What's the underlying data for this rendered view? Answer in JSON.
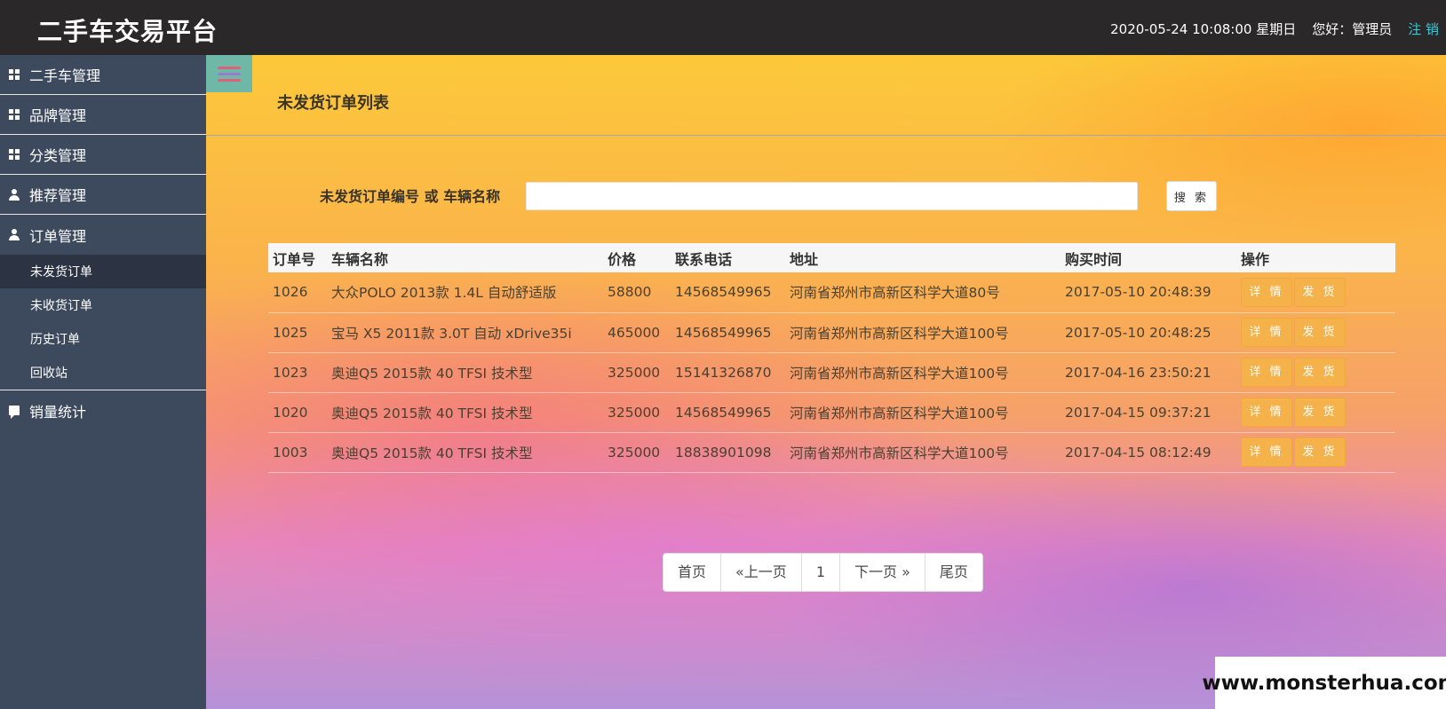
{
  "header": {
    "title": "二手车交易平台",
    "datetime": "2020-05-24 10:08:00 星期日",
    "greeting": "您好：管理员",
    "logout": "注 销"
  },
  "sidebar": {
    "groups": [
      {
        "label": "二手车管理",
        "icon": "grid-icon"
      },
      {
        "label": "品牌管理",
        "icon": "grid-icon"
      },
      {
        "label": "分类管理",
        "icon": "grid-icon"
      },
      {
        "label": "推荐管理",
        "icon": "user-icon"
      },
      {
        "label": "订单管理",
        "icon": "user-icon"
      },
      {
        "label": "销量统计",
        "icon": "chat-icon"
      }
    ],
    "order_subitems": [
      "未发货订单",
      "未收货订单",
      "历史订单",
      "回收站"
    ],
    "active_subitem": "未发货订单"
  },
  "main": {
    "heading": "未发货订单列表",
    "search_label": "未发货订单编号 或 车辆名称",
    "search_value": "",
    "search_button": "搜 索",
    "table": {
      "headers": [
        "订单号",
        "车辆名称",
        "价格",
        "联系电话",
        "地址",
        "购买时间",
        "操作"
      ],
      "rows": [
        [
          "1026",
          "大众POLO 2013款 1.4L 自动舒适版",
          "58800",
          "14568549965",
          "河南省郑州市高新区科学大道80号",
          "2017-05-10 20:48:39"
        ],
        [
          "1025",
          "宝马 X5 2011款 3.0T 自动 xDrive35i",
          "465000",
          "14568549965",
          "河南省郑州市高新区科学大道100号",
          "2017-05-10 20:48:25"
        ],
        [
          "1023",
          "奥迪Q5 2015款 40 TFSI 技术型",
          "325000",
          "15141326870",
          "河南省郑州市高新区科学大道100号",
          "2017-04-16 23:50:21"
        ],
        [
          "1020",
          "奥迪Q5 2015款 40 TFSI 技术型",
          "325000",
          "14568549965",
          "河南省郑州市高新区科学大道100号",
          "2017-04-15 09:37:21"
        ],
        [
          "1003",
          "奥迪Q5 2015款 40 TFSI 技术型",
          "325000",
          "18838901098",
          "河南省郑州市高新区科学大道100号",
          "2017-04-15 08:12:49"
        ]
      ],
      "actions": [
        "详 情",
        "发 货"
      ]
    },
    "pagination": [
      "首页",
      "«上一页",
      "1",
      "下一页 »",
      "尾页"
    ]
  },
  "watermark": "www.monsterhua.com",
  "colors": {
    "topbar": "#2a2828",
    "sidebar": "#3d4a5e",
    "sidebar_active": "#2c3444",
    "logout_link": "#3ec6d6",
    "action_button": "#f5b24a",
    "toggle_bg": "#6fb7a6",
    "toggle_lines": [
      "#e0607a",
      "#9a7bd0",
      "#e0607a"
    ]
  }
}
